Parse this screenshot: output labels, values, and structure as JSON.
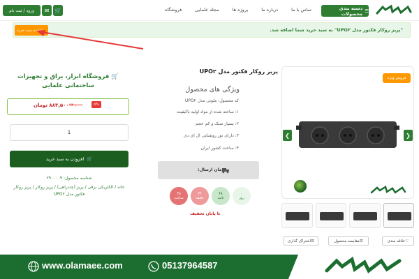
{
  "header": {
    "categories_label": "دسته بندی محصولات",
    "nav": [
      "فروشگاه",
      "مجله علمایی",
      "پروژه ها",
      "درباره ما",
      "تماس با ما"
    ],
    "login_label": "ورود / ثبت نام"
  },
  "notice": {
    "message": "\"پریز روکار فکتور مدل UPO۲\" به سبد خرید شما اضافه شد.",
    "view_cart_label": "مشاهده سبد خرید"
  },
  "gallery": {
    "sale_badge": "فروش ویژه",
    "tabs": [
      "علاقه مندی",
      "مقایسه محصول",
      "اشتراک گذاری"
    ]
  },
  "product": {
    "title": "پریز روکار فکتور مدل UPO۲",
    "features_heading": "ویژگی های محصول",
    "features": [
      "کد محصول: ملونی مدل UPO۲",
      "۱: ساخته شده از مواد اولیه باکیفیت",
      "۲: بسیار سبک و کم حجم",
      "۳: دارای نور روشنایی ال ای دی",
      "۴: ساخت کشور ایران"
    ],
    "shipping_label": "زمان ارسال:",
    "countdown": [
      {
        "value": "۰",
        "unit": "روز"
      },
      {
        "value": "۴۸",
        "unit": "ثانیه"
      },
      {
        "value": "۳۴",
        "unit": "دقیقه"
      },
      {
        "value": "۳۵",
        "unit": "ساعت"
      }
    ],
    "until_off": "تا پایان تخفیف"
  },
  "shop": {
    "title": "فروشگاه ابزار، یراق و تجهیزات ساختمانی علمایی",
    "discount": "۵%",
    "old_price": "۹۳۰,۰۰۰",
    "new_price": "۸۸۳,۵۰۰ تومان",
    "quantity": "1",
    "add_to_cart": "افزودن به سبد خرید",
    "sku": "شناسه محصول: ۲۹۰۰۰۰۹",
    "breadcrumb": "خانه / الکتریکی برقی / پریز (چندراهی) / پریز روکار / پریز روکار فکتور مدل UPO۲"
  },
  "footer": {
    "website": "www.olamaee.com",
    "phone": "05137964587"
  },
  "colors": {
    "brand_green": "#2e7d32",
    "dark_green": "#1b5e20",
    "orange": "#ff9800",
    "red": "#e53935"
  }
}
